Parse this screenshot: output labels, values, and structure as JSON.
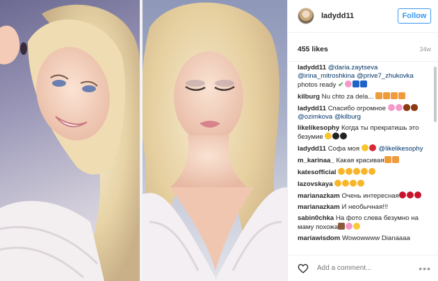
{
  "post": {
    "username": "ladydd11",
    "follow_label": "Follow",
    "likes": "455 likes",
    "age": "34w",
    "add_comment_placeholder": "Add a comment...",
    "more_label": "•••"
  },
  "comments": [
    {
      "author": "ladydd11",
      "parts": [
        {
          "t": "mention",
          "v": "@daria.zaytseva"
        },
        {
          "t": "text",
          "v": " "
        },
        {
          "t": "mention",
          "v": "@irina_mitroshkina"
        },
        {
          "t": "text",
          "v": " "
        },
        {
          "t": "mention",
          "v": "@prive7_zhukovka"
        },
        {
          "t": "text",
          "v": " photos ready "
        },
        {
          "t": "emoji",
          "v": "check"
        },
        {
          "t": "emoji",
          "v": "blossom"
        },
        {
          "t": "emoji",
          "v": "anchor"
        },
        {
          "t": "emoji",
          "v": "anchor"
        }
      ]
    },
    {
      "author": "kilburg",
      "parts": [
        {
          "t": "text",
          "v": "Nu chto za dela... "
        },
        {
          "t": "emoji",
          "v": "fox"
        },
        {
          "t": "emoji",
          "v": "fox"
        },
        {
          "t": "emoji",
          "v": "fox"
        },
        {
          "t": "emoji",
          "v": "fox"
        }
      ]
    },
    {
      "author": "ladydd11",
      "parts": [
        {
          "t": "text",
          "v": "Спасибо огромное "
        },
        {
          "t": "emoji",
          "v": "blossom"
        },
        {
          "t": "emoji",
          "v": "blossom"
        },
        {
          "t": "emoji",
          "v": "football"
        },
        {
          "t": "emoji",
          "v": "football"
        },
        {
          "t": "text",
          "v": " "
        },
        {
          "t": "mention",
          "v": "@ozimkova"
        },
        {
          "t": "text",
          "v": " "
        },
        {
          "t": "mention",
          "v": "@kilburg"
        }
      ]
    },
    {
      "author": "likelikesophy",
      "parts": [
        {
          "t": "text",
          "v": "Когда ты прекратишь это безумие "
        },
        {
          "t": "emoji",
          "v": "laugh"
        },
        {
          "t": "emoji",
          "v": "bomb"
        },
        {
          "t": "emoji",
          "v": "bomb"
        }
      ]
    },
    {
      "author": "ladydd11",
      "parts": [
        {
          "t": "text",
          "v": "Софа моя "
        },
        {
          "t": "emoji",
          "v": "laugh"
        },
        {
          "t": "emoji",
          "v": "heart"
        },
        {
          "t": "text",
          "v": " "
        },
        {
          "t": "mention",
          "v": "@likelikesophy"
        }
      ]
    },
    {
      "author": "m_karinaa_",
      "parts": [
        {
          "t": "text",
          "v": "Какая красивая"
        },
        {
          "t": "emoji",
          "v": "fox"
        },
        {
          "t": "emoji",
          "v": "fox"
        }
      ]
    },
    {
      "author": "katesofficial",
      "parts": [
        {
          "t": "emoji",
          "v": "heye"
        },
        {
          "t": "emoji",
          "v": "heye"
        },
        {
          "t": "emoji",
          "v": "heye"
        },
        {
          "t": "emoji",
          "v": "heye"
        },
        {
          "t": "emoji",
          "v": "heye"
        }
      ]
    },
    {
      "author": "lazovskaya",
      "parts": [
        {
          "t": "emoji",
          "v": "heye"
        },
        {
          "t": "emoji",
          "v": "heye"
        },
        {
          "t": "emoji",
          "v": "heye"
        },
        {
          "t": "emoji",
          "v": "heye"
        }
      ]
    },
    {
      "author": "marianazkam",
      "parts": [
        {
          "t": "text",
          "v": "Очень интересная"
        },
        {
          "t": "emoji",
          "v": "rose"
        },
        {
          "t": "emoji",
          "v": "rose"
        },
        {
          "t": "emoji",
          "v": "rose"
        }
      ]
    },
    {
      "author": "marianazkam",
      "parts": [
        {
          "t": "text",
          "v": "И необычная!!!"
        }
      ]
    },
    {
      "author": "sabin0chka",
      "parts": [
        {
          "t": "text",
          "v": "На фото слева безумно на маму похожа"
        },
        {
          "t": "emoji",
          "v": "family"
        },
        {
          "t": "emoji",
          "v": "blossom"
        },
        {
          "t": "emoji",
          "v": "grin"
        }
      ]
    },
    {
      "author": "mariawisdom",
      "parts": [
        {
          "t": "text",
          "v": "Wowowwww Dianaaaa"
        }
      ]
    }
  ],
  "icons": {
    "like": "heart-outline-icon",
    "more": "more-options-icon",
    "avatar": "avatar-image"
  },
  "colors": {
    "accent": "#3897f0",
    "mention": "#003569",
    "muted": "#999999",
    "border": "#efefef"
  }
}
